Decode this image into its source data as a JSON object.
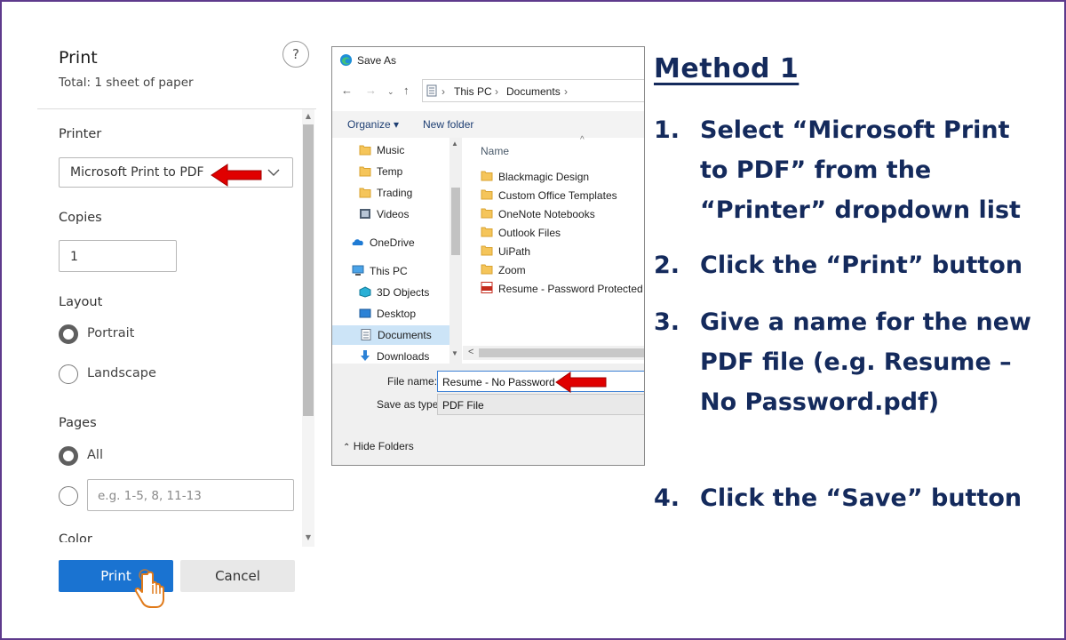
{
  "print_panel": {
    "title": "Print",
    "subtitle": "Total: 1 sheet of paper",
    "help_label": "?",
    "printer_label": "Printer",
    "printer_value": "Microsoft Print to PDF",
    "copies_label": "Copies",
    "copies_value": "1",
    "layout_label": "Layout",
    "layout_options": [
      {
        "label": "Portrait",
        "checked": true
      },
      {
        "label": "Landscape",
        "checked": false
      }
    ],
    "pages_label": "Pages",
    "pages_all_label": "All",
    "pages_placeholder": "e.g. 1-5, 8, 11-13",
    "color_label": "Color",
    "print_button": "Print",
    "cancel_button": "Cancel",
    "primary_color": "#1a73d1"
  },
  "save_as": {
    "title": "Save As",
    "breadcrumb": [
      "This PC",
      "Documents"
    ],
    "toolbar": {
      "organize": "Organize ▾",
      "new_folder": "New folder"
    },
    "tree_items": [
      {
        "label": "Music",
        "icon": "folder-icon"
      },
      {
        "label": "Temp",
        "icon": "folder-icon"
      },
      {
        "label": "Trading",
        "icon": "folder-icon"
      },
      {
        "label": "Videos",
        "icon": "videos-icon"
      },
      {
        "label": "OneDrive",
        "icon": "onedrive-icon"
      },
      {
        "label": "This PC",
        "icon": "pc-icon"
      },
      {
        "label": "3D Objects",
        "icon": "3d-objects-icon"
      },
      {
        "label": "Desktop",
        "icon": "desktop-icon"
      },
      {
        "label": "Documents",
        "icon": "documents-icon",
        "selected": true
      },
      {
        "label": "Downloads",
        "icon": "downloads-icon"
      }
    ],
    "column_header": "Name",
    "files": [
      {
        "label": "Blackmagic Design",
        "icon": "folder-icon"
      },
      {
        "label": "Custom Office Templates",
        "icon": "folder-icon"
      },
      {
        "label": "OneNote Notebooks",
        "icon": "folder-icon"
      },
      {
        "label": "Outlook Files",
        "icon": "folder-icon"
      },
      {
        "label": "UiPath",
        "icon": "folder-icon"
      },
      {
        "label": "Zoom",
        "icon": "folder-icon"
      },
      {
        "label": "Resume - Password Protected PDF",
        "icon": "pdf-file-icon"
      }
    ],
    "file_name_label": "File name:",
    "file_name_value": "Resume - No Password",
    "save_as_type_label": "Save as type:",
    "save_as_type_value": "PDF File",
    "hide_folders": "Hide Folders"
  },
  "instructions": {
    "title": "Method 1",
    "steps": [
      {
        "num": "1.",
        "text": "Select “Microsoft Print to PDF” from the “Printer” dropdown list"
      },
      {
        "num": "2.",
        "text": "Click the “Print” button"
      },
      {
        "num": "3.",
        "text": "Give a name for the new PDF file (e.g. Resume – No Password.pdf)"
      },
      {
        "num": "4.",
        "text": "Click the “Save” button"
      }
    ],
    "text_color": "#142a5c"
  },
  "annotation_color": "#e00000"
}
